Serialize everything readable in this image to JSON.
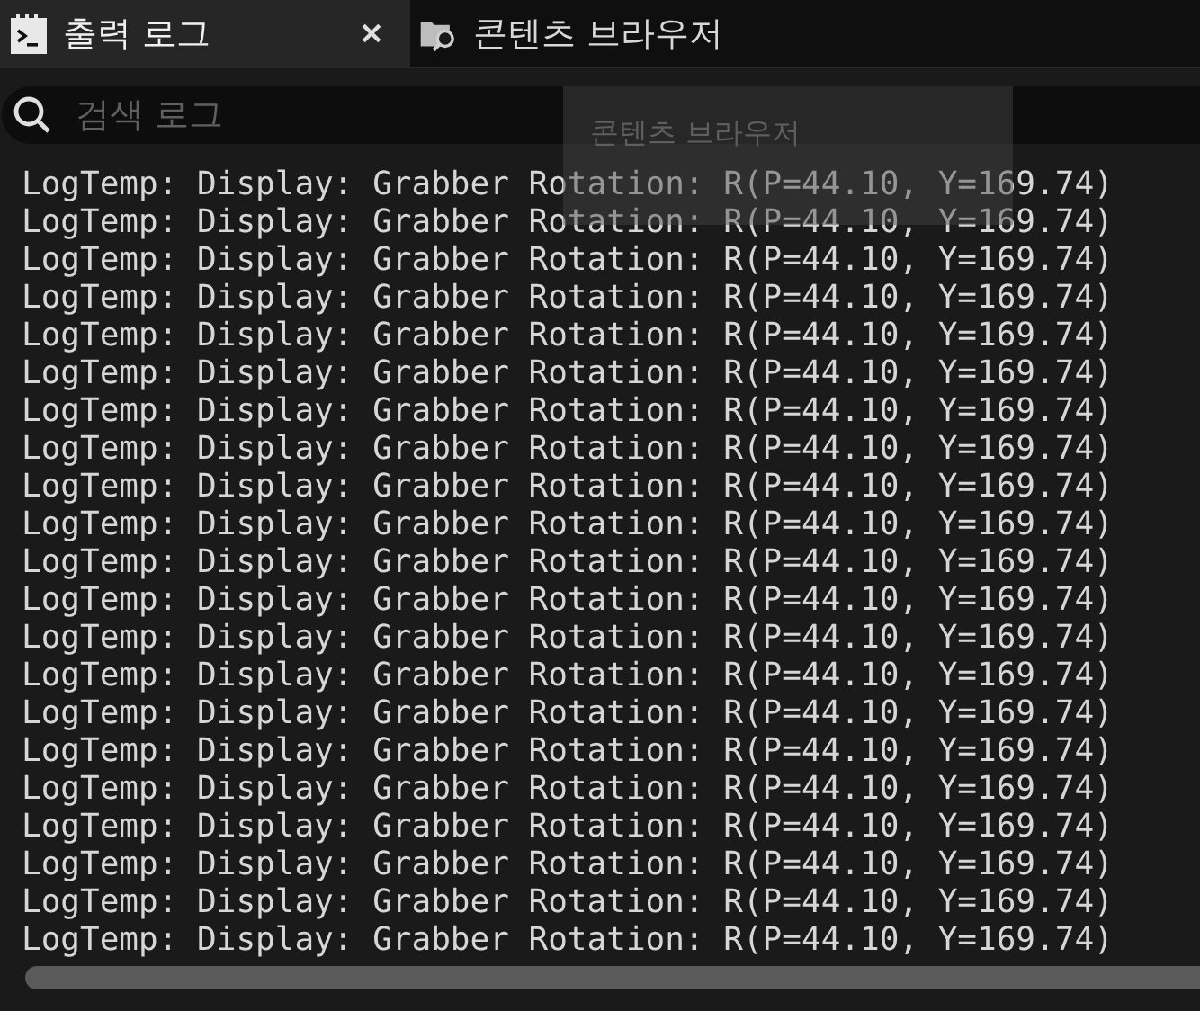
{
  "tabs": [
    {
      "label": "출력 로그",
      "selected": true,
      "closable": true
    },
    {
      "label": "콘텐츠 브라우저",
      "selected": false,
      "closable": false
    }
  ],
  "search": {
    "placeholder": "검색 로그"
  },
  "tooltip": {
    "title": "콘텐츠 브라우저"
  },
  "log_lines": [
    "LogTemp: Display: Grabber Rotation: R(P=44.10, Y=169.74)",
    "LogTemp: Display: Grabber Rotation: R(P=44.10, Y=169.74)",
    "LogTemp: Display: Grabber Rotation: R(P=44.10, Y=169.74)",
    "LogTemp: Display: Grabber Rotation: R(P=44.10, Y=169.74)",
    "LogTemp: Display: Grabber Rotation: R(P=44.10, Y=169.74)",
    "LogTemp: Display: Grabber Rotation: R(P=44.10, Y=169.74)",
    "LogTemp: Display: Grabber Rotation: R(P=44.10, Y=169.74)",
    "LogTemp: Display: Grabber Rotation: R(P=44.10, Y=169.74)",
    "LogTemp: Display: Grabber Rotation: R(P=44.10, Y=169.74)",
    "LogTemp: Display: Grabber Rotation: R(P=44.10, Y=169.74)",
    "LogTemp: Display: Grabber Rotation: R(P=44.10, Y=169.74)",
    "LogTemp: Display: Grabber Rotation: R(P=44.10, Y=169.74)",
    "LogTemp: Display: Grabber Rotation: R(P=44.10, Y=169.74)",
    "LogTemp: Display: Grabber Rotation: R(P=44.10, Y=169.74)",
    "LogTemp: Display: Grabber Rotation: R(P=44.10, Y=169.74)",
    "LogTemp: Display: Grabber Rotation: R(P=44.10, Y=169.74)",
    "LogTemp: Display: Grabber Rotation: R(P=44.10, Y=169.74)",
    "LogTemp: Display: Grabber Rotation: R(P=44.10, Y=169.74)",
    "LogTemp: Display: Grabber Rotation: R(P=44.10, Y=169.74)",
    "LogTemp: Display: Grabber Rotation: R(P=44.10, Y=169.74)",
    "LogTemp: Display: Grabber Rotation: R(P=44.10, Y=169.74)"
  ]
}
